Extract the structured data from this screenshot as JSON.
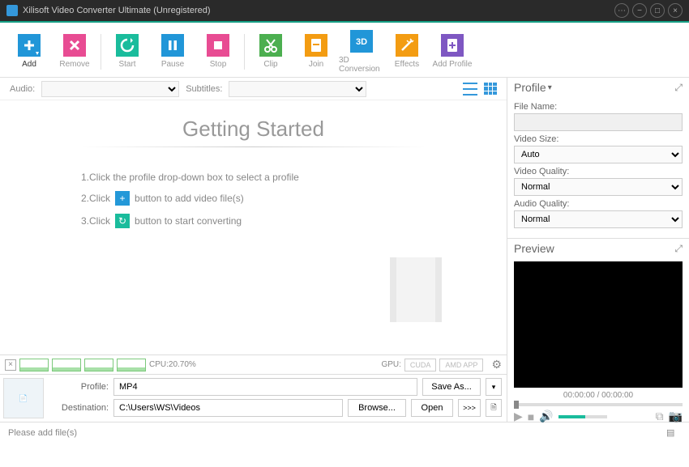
{
  "title": "Xilisoft Video Converter Ultimate (Unregistered)",
  "toolbar": {
    "add": "Add",
    "remove": "Remove",
    "start": "Start",
    "pause": "Pause",
    "stop": "Stop",
    "clip": "Clip",
    "join": "Join",
    "conv3d": "3D Conversion",
    "effects": "Effects",
    "addprofile": "Add Profile"
  },
  "subbar": {
    "audio": "Audio:",
    "subtitles": "Subtitles:"
  },
  "getting": {
    "heading": "Getting Started",
    "s1a": "1.Click the profile drop-down box to select a profile",
    "s2a": "2.Click",
    "s2b": "button to add video file(s)",
    "s3a": "3.Click",
    "s3b": "button to start converting"
  },
  "perf": {
    "cpu": "CPU:20.70%",
    "gpu": "GPU:",
    "cuda": "CUDA",
    "amd": "AMD APP"
  },
  "profile": {
    "label_profile": "Profile:",
    "profile_value": "MP4",
    "label_dest": "Destination:",
    "dest_value": "C:\\Users\\WS\\Videos",
    "saveas": "Save As...",
    "browse": "Browse...",
    "open": "Open",
    "more": ">>>"
  },
  "status": {
    "msg": "Please add file(s)"
  },
  "rpanel": {
    "profile_head": "Profile",
    "filename": "File Name:",
    "vsize": "Video Size:",
    "vsize_val": "Auto",
    "vqual": "Video Quality:",
    "vqual_val": "Normal",
    "aqual": "Audio Quality:",
    "aqual_val": "Normal",
    "preview_head": "Preview",
    "time": "00:00:00 / 00:00:00"
  }
}
